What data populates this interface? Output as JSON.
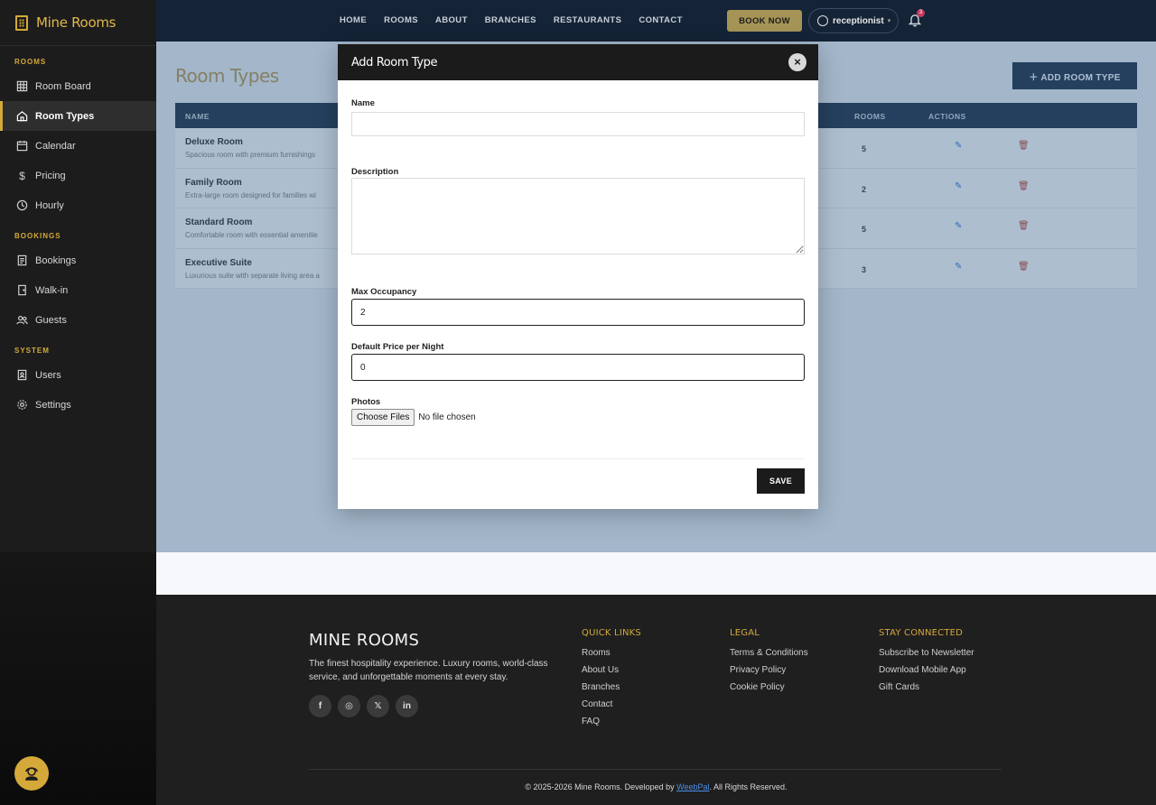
{
  "brand": {
    "name": "Mine Rooms"
  },
  "sidebar": {
    "sections": [
      {
        "title": "ROOMS",
        "items": [
          {
            "label": "Room Board",
            "icon": "grid-icon"
          },
          {
            "label": "Room Types",
            "icon": "home-icon",
            "active": true
          },
          {
            "label": "Calendar",
            "icon": "calendar-icon"
          },
          {
            "label": "Pricing",
            "icon": "dollar-icon"
          },
          {
            "label": "Hourly",
            "icon": "clock-icon"
          }
        ]
      },
      {
        "title": "BOOKINGS",
        "items": [
          {
            "label": "Bookings",
            "icon": "document-icon"
          },
          {
            "label": "Walk-in",
            "icon": "door-icon"
          },
          {
            "label": "Guests",
            "icon": "users-icon"
          }
        ]
      },
      {
        "title": "SYSTEM",
        "items": [
          {
            "label": "Users",
            "icon": "id-badge-icon"
          },
          {
            "label": "Settings",
            "icon": "gear-icon"
          }
        ]
      }
    ]
  },
  "nav": {
    "links": [
      "HOME",
      "ROOMS",
      "ABOUT",
      "BRANCHES",
      "RESTAURANTS",
      "CONTACT"
    ],
    "book_now": "BOOK NOW",
    "user": "receptionist",
    "notifications": "3"
  },
  "page": {
    "title": "Room Types",
    "add_button": "ADD ROOM TYPE",
    "table": {
      "headers": {
        "name": "NAME",
        "rooms": "ROOMS",
        "actions": "ACTIONS"
      },
      "rows": [
        {
          "name": "Deluxe Room",
          "desc": "Spacious room with premium furnishings",
          "rooms": "5"
        },
        {
          "name": "Family Room",
          "desc": "Extra-large room designed for families wi",
          "rooms": "2"
        },
        {
          "name": "Standard Room",
          "desc": "Comfortable room with essential amenitie",
          "rooms": "5"
        },
        {
          "name": "Executive Suite",
          "desc": "Luxurious suite with separate living area a",
          "rooms": "3"
        }
      ]
    }
  },
  "modal": {
    "title": "Add Room Type",
    "name_label": "Name",
    "name_value": "",
    "description_label": "Description",
    "description_value": "",
    "max_occupancy_label": "Max Occupancy",
    "max_occupancy_value": "2",
    "price_label": "Default Price per Night",
    "price_value": "0",
    "photos_label": "Photos",
    "choose_files": "Choose Files",
    "no_file": "No file chosen",
    "save": "SAVE"
  },
  "footer": {
    "brand": "MINE ROOMS",
    "tagline": "The finest hospitality experience. Luxury rooms, world-class service, and unforgettable moments at every stay.",
    "social": [
      "facebook-icon",
      "instagram-icon",
      "x-icon",
      "linkedin-icon"
    ],
    "quick_links": {
      "title": "QUICK LINKS",
      "items": [
        "Rooms",
        "About Us",
        "Branches",
        "Contact",
        "FAQ"
      ]
    },
    "legal": {
      "title": "LEGAL",
      "items": [
        "Terms & Conditions",
        "Privacy Policy",
        "Cookie Policy"
      ]
    },
    "stay_connected": {
      "title": "STAY CONNECTED",
      "items": [
        "Subscribe to Newsletter",
        "Download Mobile App",
        "Gift Cards"
      ]
    },
    "copyright_prefix": "© 2025-2026 Mine Rooms. Developed by ",
    "developer": "WeebPal",
    "copyright_suffix": ". All Rights Reserved."
  },
  "colors": {
    "accent": "#d4a93a",
    "navy": "#13263d",
    "dark": "#1b1b1b"
  }
}
